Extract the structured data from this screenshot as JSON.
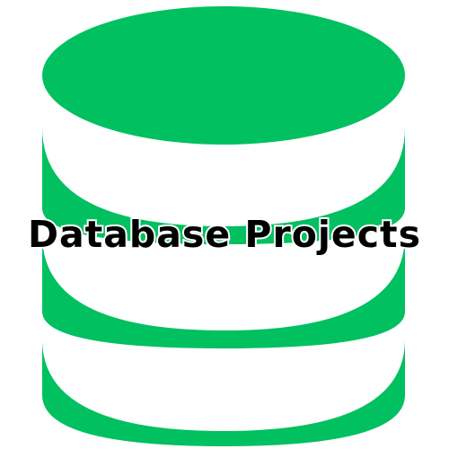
{
  "caption": "Database Projects",
  "icon": {
    "name": "database-icon",
    "color": "#00c060",
    "slot_color": "#ffffff"
  }
}
